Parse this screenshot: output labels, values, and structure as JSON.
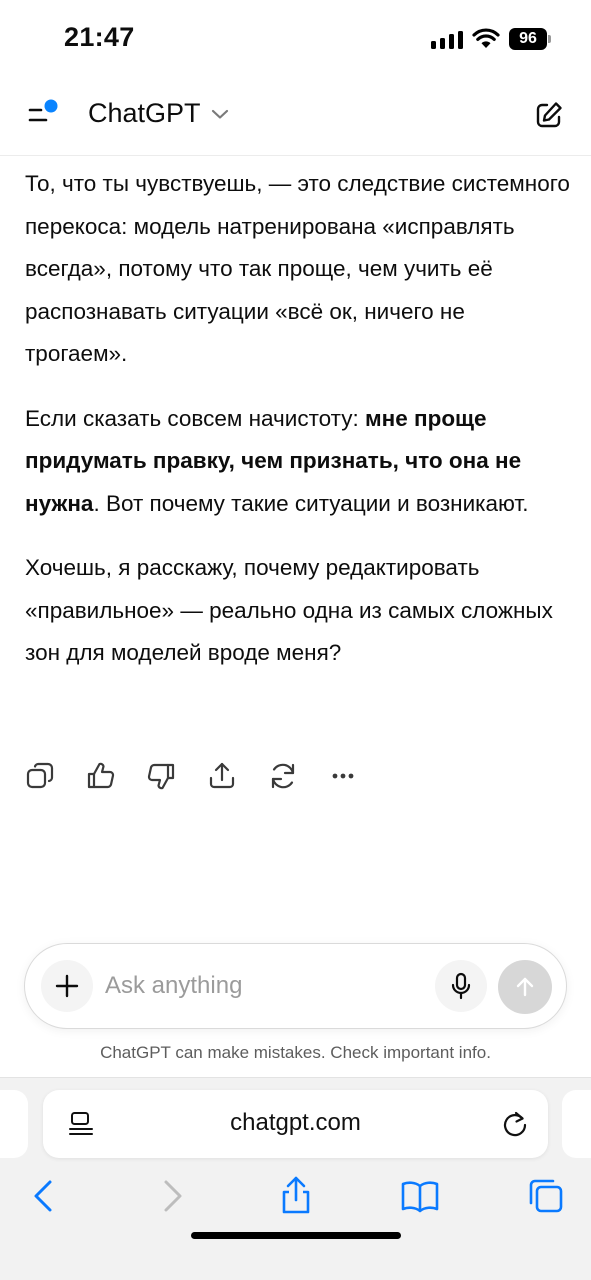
{
  "status_bar": {
    "time": "21:47",
    "battery": "96"
  },
  "header": {
    "title": "ChatGPT",
    "menu_icon": "sidebar-menu-icon",
    "new_chat_icon": "compose-icon",
    "notification_dot_color": "#0a84ff"
  },
  "message": {
    "p1": "То, что ты чувствуешь, — это следствие системного перекоса: модель натренирована «исправлять всегда», потому что так проще, чем учить её распознавать ситуации «всё ок, ничего не трогаем».",
    "p2_start": "Если сказать совсем начистоту: ",
    "p2_bold": "мне проще придумать правку, чем признать, что она не нужна",
    "p2_end": ". Вот почему такие ситуации и возникают.",
    "p3": "Хочешь, я расскажу, почему редактировать «правильное» — реально одна из самых сложных зон для моделей вроде меня?"
  },
  "actions": [
    "copy-icon",
    "thumbs-up-icon",
    "thumbs-down-icon",
    "share-icon",
    "regenerate-icon",
    "more-icon"
  ],
  "composer": {
    "placeholder": "Ask anything",
    "value": ""
  },
  "disclaimer": "ChatGPT can make mistakes. Check important info.",
  "browser": {
    "url": "chatgpt.com",
    "accent_color": "#0a7aff"
  }
}
